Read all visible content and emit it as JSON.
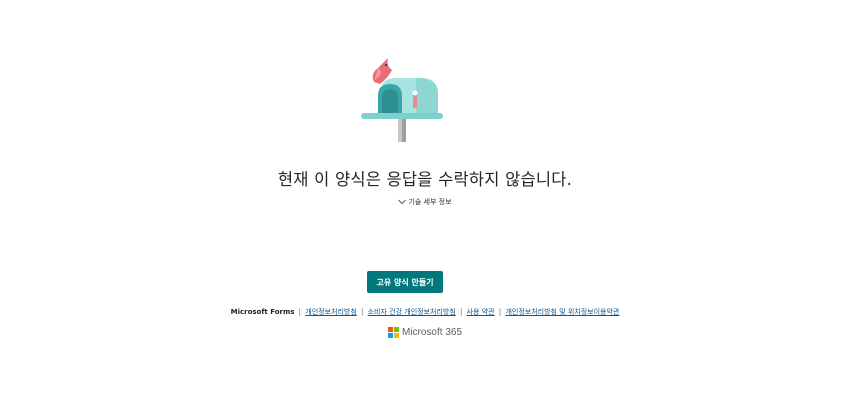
{
  "status": {
    "message": "현재 이 양식은 응답을 수락하지 않습니다.",
    "tech_details_label": "기술 세부 정보"
  },
  "actions": {
    "create_form_label": "고유 양식 만들기"
  },
  "footer": {
    "brand": "Microsoft Forms",
    "links": [
      "개인정보처리방침",
      "소비자 건강 개인정보처리방침",
      "사용 약관",
      "개인정보처리방침 및 위치정보이용약관"
    ],
    "separator": "|",
    "logo_text": "Microsoft 365",
    "logo_colors": [
      "#f25022",
      "#7fba00",
      "#00a4ef",
      "#ffb900"
    ]
  },
  "colors": {
    "accent": "#03787c",
    "link": "#0f548c"
  },
  "icons": {
    "illustration": "mailbox-icon",
    "chevron": "chevron-down-icon"
  }
}
